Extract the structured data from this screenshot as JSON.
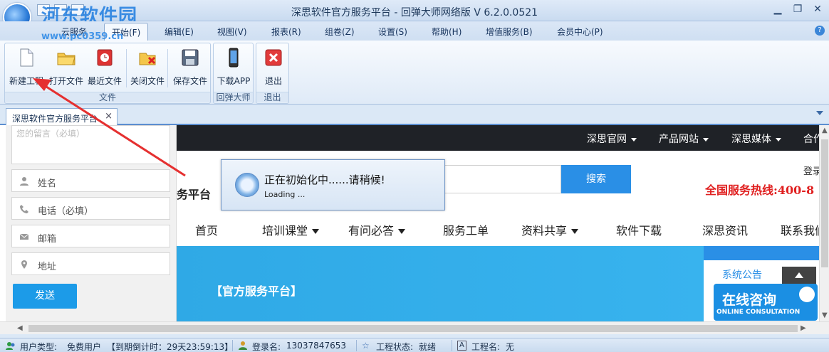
{
  "window": {
    "title": "深思软件官方服务平台 - 回弹大师网络版 V 6.2.0.0521",
    "watermark": "河东软件园",
    "watermark_url": "www.pc0359.cn"
  },
  "menu": {
    "tabs": [
      "云服务",
      "开始(F)",
      "编辑(E)",
      "视图(V)",
      "报表(R)",
      "组卷(Z)",
      "设置(S)",
      "帮助(H)",
      "增值服务(B)",
      "会员中心(P)"
    ],
    "active": "开始(F)"
  },
  "ribbon": {
    "file_group": {
      "label": "文件",
      "buttons": [
        "新建工程",
        "打开文件",
        "最近文件",
        "关闭文件",
        "保存文件"
      ]
    },
    "app_group": {
      "label": "回弹大师",
      "button": "下载APP"
    },
    "exit_group": {
      "label": "退出",
      "button": "退出"
    }
  },
  "doc_tab": {
    "label": "深思软件官方服务平台"
  },
  "form": {
    "textarea_placeholder": "您的留言（必填）",
    "fields": [
      "姓名",
      "电话（必填）",
      "邮箱",
      "地址"
    ],
    "submit": "发送"
  },
  "site": {
    "top_nav": [
      "深思官网",
      "产品网站",
      "深思媒体",
      "合作"
    ],
    "brand_tail": "务平台",
    "search_button": "搜索",
    "login": "登录",
    "hotline": "全国服务热线:400-8",
    "nav": [
      "首页",
      "培训课堂",
      "有问必答",
      "服务工单",
      "资料共享",
      "软件下载",
      "深思资讯",
      "联系我们"
    ],
    "banner": "【官方服务平台】",
    "notice": "系统公告",
    "consult_title": "在线咨询",
    "consult_sub": "ONLINE CONSULTATION"
  },
  "loading": {
    "message": "正在初始化中......请稍候!",
    "sub": "Loading ..."
  },
  "status": {
    "user_type_label": "用户类型:",
    "user_type": "免费用户",
    "countdown": "【到期倒计时：29天23:59:13】",
    "login_label": "登录名:",
    "login_name": "13037847653",
    "project_state_label": "工程状态:",
    "project_state": "就绪",
    "project_name_label": "工程名:",
    "project_name": "无"
  },
  "colors": {
    "accent": "#2a8fe6",
    "hotline": "#e02020",
    "arrow": "#e53030"
  }
}
